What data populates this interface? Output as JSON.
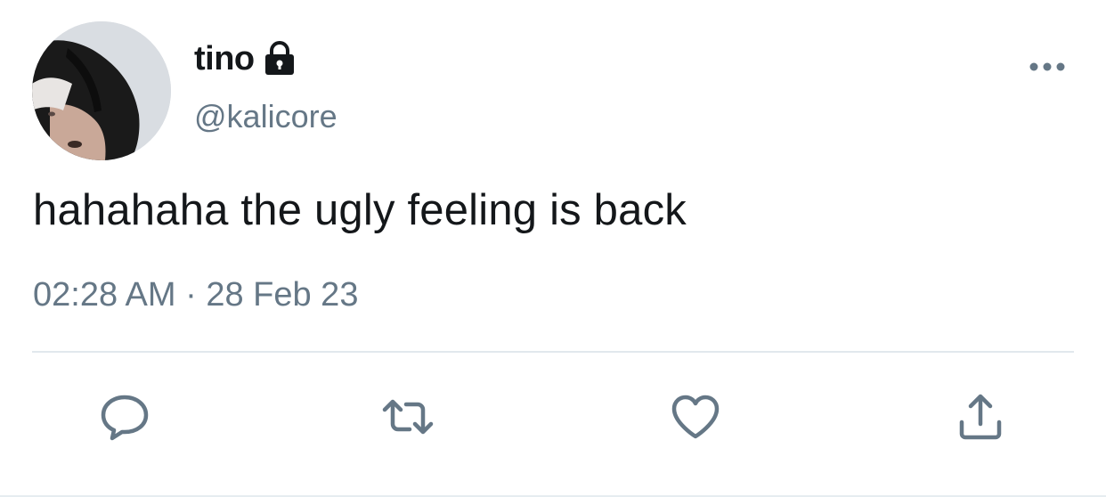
{
  "tweet": {
    "author": {
      "display_name": "tino",
      "handle": "@kalicore",
      "protected_icon": "lock-icon",
      "avatar_icon": "avatar-photo"
    },
    "text": "hahahaha the ugly feeling is back",
    "timestamp": "02:28 AM · 28 Feb 23",
    "more_icon": "more-options-icon",
    "actions": [
      {
        "name": "reply",
        "icon": "reply-icon"
      },
      {
        "name": "retweet",
        "icon": "retweet-icon"
      },
      {
        "name": "like",
        "icon": "heart-icon"
      },
      {
        "name": "share",
        "icon": "share-icon"
      }
    ]
  },
  "colors": {
    "text_primary": "#14171a",
    "text_secondary": "#657786",
    "divider": "#e1e8ed",
    "icon": "#657786"
  }
}
